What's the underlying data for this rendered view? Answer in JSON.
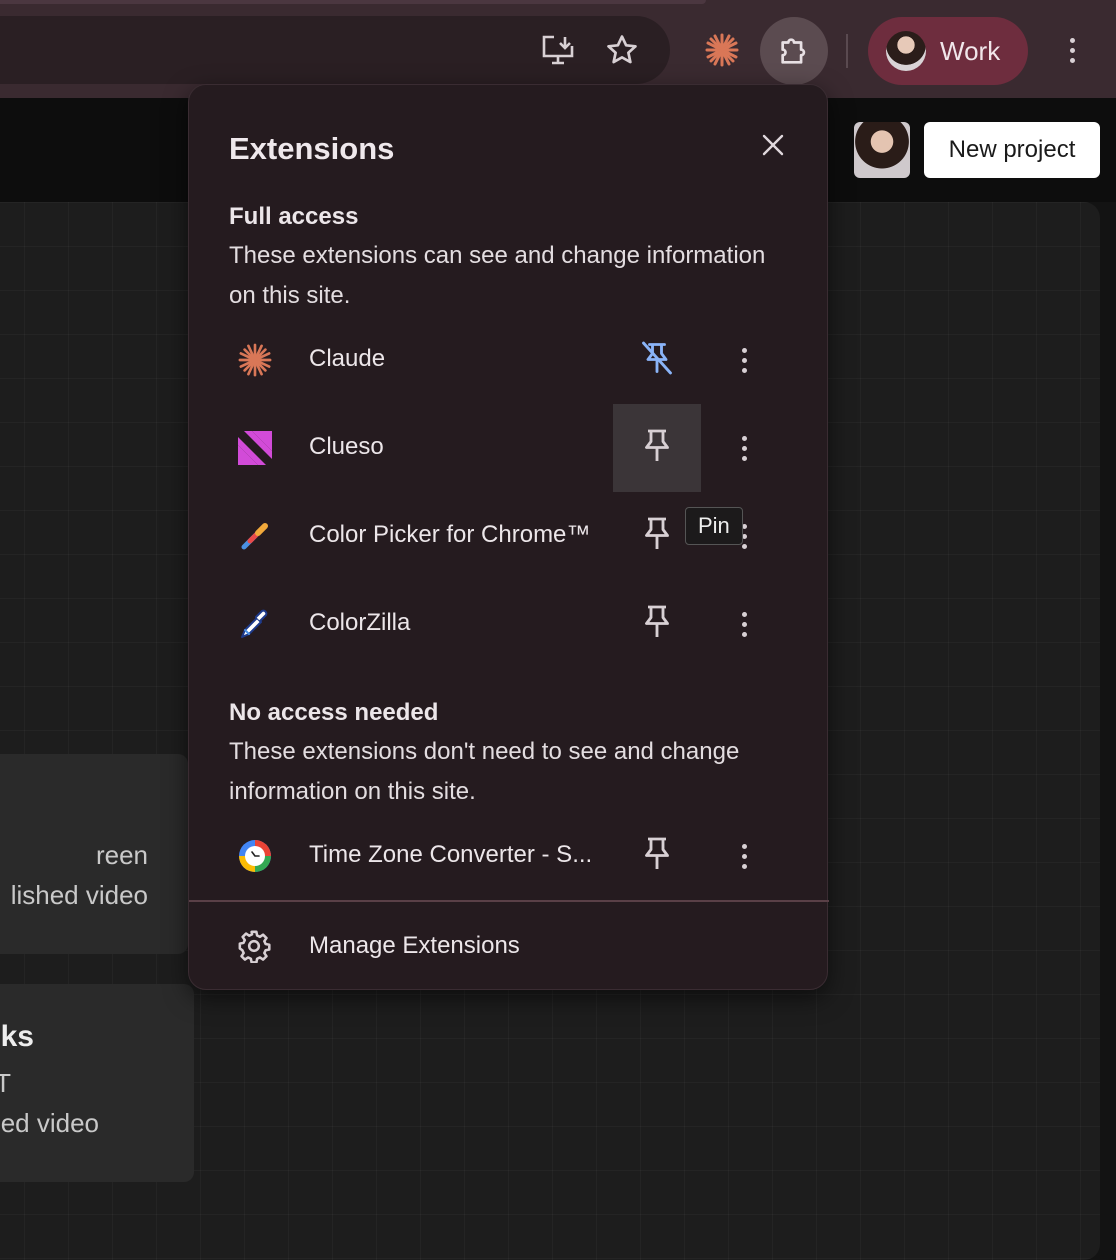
{
  "toolbar": {
    "profile_label": "Work",
    "icons": [
      "install-app-icon",
      "bookmark-star-icon",
      "claude-extension-icon",
      "extensions-puzzle-icon",
      "chrome-menu-icon"
    ],
    "colors": {
      "toolbar_bg": "#3a2a30",
      "profile_chip": "#6e2d3e",
      "claude_orange": "#d97757"
    }
  },
  "page": {
    "new_project_label": "New project",
    "card1_lines": [
      "reen",
      "lished video"
    ],
    "card2_lines": [
      "ks",
      "PT",
      "ed video"
    ]
  },
  "popup": {
    "title": "Extensions",
    "full_access": {
      "heading": "Full access",
      "description": "These extensions can see and change information on this site."
    },
    "extensions_full": [
      {
        "name": "Claude",
        "pin_state": "pinned",
        "icon": "claude-starburst-icon"
      },
      {
        "name": "Clueso",
        "pin_state": "unpinned-hover",
        "icon": "clueso-logo-icon"
      },
      {
        "name": "Color Picker for Chrome™",
        "pin_state": "unpinned",
        "icon": "color-picker-icon"
      },
      {
        "name": "ColorZilla",
        "pin_state": "unpinned",
        "icon": "eyedropper-icon"
      }
    ],
    "no_access": {
      "heading": "No access needed",
      "description": "These extensions don't need to see and change information on this site."
    },
    "extensions_none": [
      {
        "name": "Time Zone Converter - S...",
        "pin_state": "unpinned",
        "icon": "time-zone-converter-icon"
      }
    ],
    "tooltip": "Pin",
    "manage_label": "Manage Extensions",
    "colors": {
      "pinned_blue": "#8ab4f8",
      "clueso_pink": "#d24bd8"
    }
  }
}
